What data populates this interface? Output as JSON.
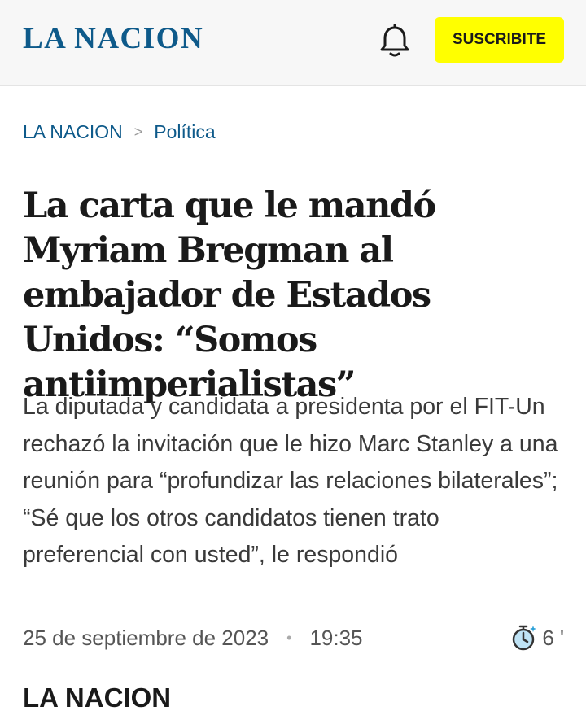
{
  "header": {
    "logo": "LA NACION",
    "bell_icon": "bell-icon",
    "subscribe_label": "SUSCRIBITE",
    "subscribe_color": "#ffff00",
    "logo_color": "#0e5a8a"
  },
  "breadcrumb": {
    "home": "LA NACION",
    "separator": ">",
    "section": "Política"
  },
  "article": {
    "headline": "La carta que le mandó Myriam Bregman al embajador de Estados Unidos: “Somos antiimperialistas”",
    "summary": "La diputada y candidata a presidenta por el FIT-Un rechazó la invitación que le hizo Marc Stanley a una reunión para “profundizar las relaciones bilaterales”; “Sé que los otros candidatos tienen trato preferencial con usted”, le respondió",
    "date": "25 de septiembre de 2023",
    "time": "19:35",
    "read_time": "6 '",
    "timer_icon": "timer-icon",
    "author": "LA NACION"
  }
}
